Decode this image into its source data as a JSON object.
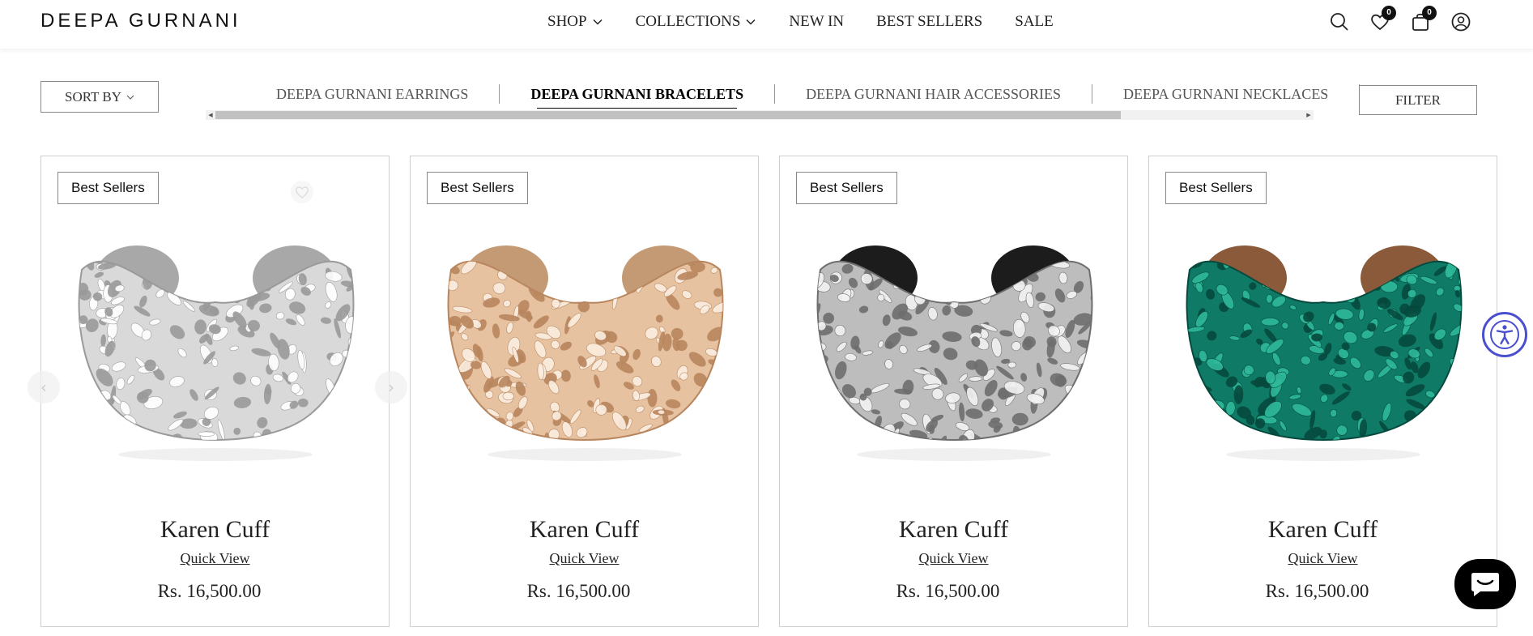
{
  "header": {
    "logo": "DEEPA GURNANI",
    "nav": [
      {
        "label": "SHOP",
        "dropdown": true
      },
      {
        "label": "COLLECTIONS",
        "dropdown": true
      },
      {
        "label": "NEW IN",
        "dropdown": false
      },
      {
        "label": "BEST SELLERS",
        "dropdown": false
      },
      {
        "label": "SALE",
        "dropdown": false
      }
    ],
    "wishlist_count": "0",
    "cart_count": "0"
  },
  "toolbar": {
    "sort_label": "SORT BY",
    "filter_label": "FILTER",
    "category_tabs": [
      {
        "label": "DEEPA GURNANI EARRINGS",
        "active": false
      },
      {
        "label": "DEEPA GURNANI BRACELETS",
        "active": true
      },
      {
        "label": "DEEPA GURNANI HAIR ACCESSORIES",
        "active": false
      },
      {
        "label": "DEEPA GURNANI NECKLACES",
        "active": false
      }
    ]
  },
  "products": [
    {
      "badge": "Best Sellers",
      "title": "Karen Cuff",
      "quick_view": "Quick View",
      "price": "Rs. 16,500.00",
      "variant": "silver-white",
      "colors": {
        "base": "#d9d9d9",
        "stone": "#ffffff",
        "shade": "#9a9a9a",
        "lining": "#a8a8a8"
      }
    },
    {
      "badge": "Best Sellers",
      "title": "Karen Cuff",
      "quick_view": "Quick View",
      "price": "Rs. 16,500.00",
      "variant": "rose-gold",
      "colors": {
        "base": "#e6c2a0",
        "stone": "#fbeee0",
        "shade": "#b8865e",
        "lining": "#c49a74"
      }
    },
    {
      "badge": "Best Sellers",
      "title": "Karen Cuff",
      "quick_view": "Quick View",
      "price": "Rs. 16,500.00",
      "variant": "silver-black",
      "colors": {
        "base": "#bdbdbd",
        "stone": "#f2f2f2",
        "shade": "#6e6e6e",
        "lining": "#1c1c1c"
      }
    },
    {
      "badge": "Best Sellers",
      "title": "Karen Cuff",
      "quick_view": "Quick View",
      "price": "Rs. 16,500.00",
      "variant": "emerald",
      "colors": {
        "base": "#0f7a66",
        "stone": "#2fb89a",
        "shade": "#064a3d",
        "lining": "#8a5a3a"
      }
    }
  ]
}
